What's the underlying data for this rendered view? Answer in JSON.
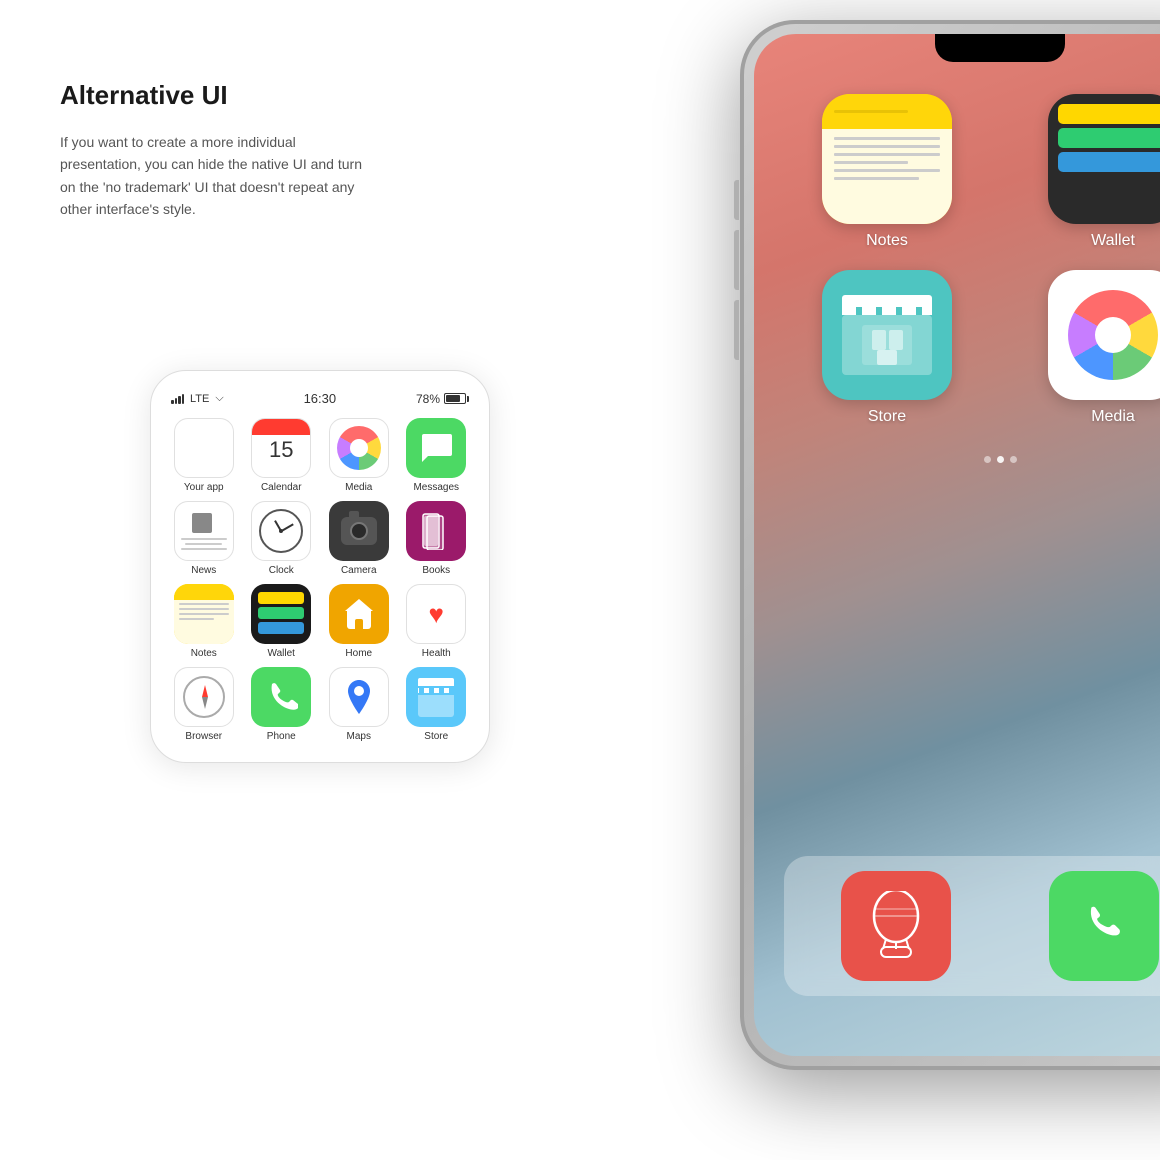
{
  "page": {
    "title": "Alternative UI",
    "description": "If you want to create a more individual presentation, you can hide the native UI and turn on the 'no trademark' UI that doesn't repeat any other interface's style."
  },
  "phone_mockup": {
    "status": {
      "signal": "LTE",
      "wifi": true,
      "time": "16:30",
      "battery": "78%"
    },
    "apps": [
      {
        "id": "your-app",
        "label": "Your app",
        "icon": "blank"
      },
      {
        "id": "calendar",
        "label": "Calendar",
        "icon": "calendar",
        "number": "15"
      },
      {
        "id": "media",
        "label": "Media",
        "icon": "media"
      },
      {
        "id": "messages",
        "label": "Messages",
        "icon": "messages"
      },
      {
        "id": "news",
        "label": "News",
        "icon": "news"
      },
      {
        "id": "clock",
        "label": "Clock",
        "icon": "clock"
      },
      {
        "id": "camera",
        "label": "Camera",
        "icon": "camera"
      },
      {
        "id": "books",
        "label": "Books",
        "icon": "books"
      },
      {
        "id": "notes",
        "label": "Notes",
        "icon": "notes"
      },
      {
        "id": "wallet",
        "label": "Wallet",
        "icon": "wallet"
      },
      {
        "id": "home",
        "label": "Home",
        "icon": "home"
      },
      {
        "id": "health",
        "label": "Health",
        "icon": "health"
      },
      {
        "id": "browser",
        "label": "Browser",
        "icon": "browser"
      },
      {
        "id": "phone",
        "label": "Phone",
        "icon": "phone"
      },
      {
        "id": "maps",
        "label": "Maps",
        "icon": "maps"
      },
      {
        "id": "store",
        "label": "Store",
        "icon": "store"
      }
    ]
  },
  "large_screen": {
    "apps": [
      {
        "label": "Notes",
        "icon": "notes"
      },
      {
        "label": "Wallet",
        "icon": "wallet"
      },
      {
        "label": "Store",
        "icon": "store"
      },
      {
        "label": "Media",
        "icon": "media"
      }
    ],
    "dock": [
      {
        "label": "",
        "icon": "balloon"
      },
      {
        "label": "",
        "icon": "phone"
      }
    ]
  },
  "colors": {
    "messages_green": "#4cd964",
    "notes_yellow": "#ffd60a",
    "books_purple": "#9b1a6a",
    "home_orange": "#f0a500",
    "camera_dark": "#3a3a3a",
    "store_teal": "#5ac8fa",
    "health_red": "#ff3b30",
    "phone_green": "#4cd964",
    "balloon_red": "#e8524a"
  }
}
